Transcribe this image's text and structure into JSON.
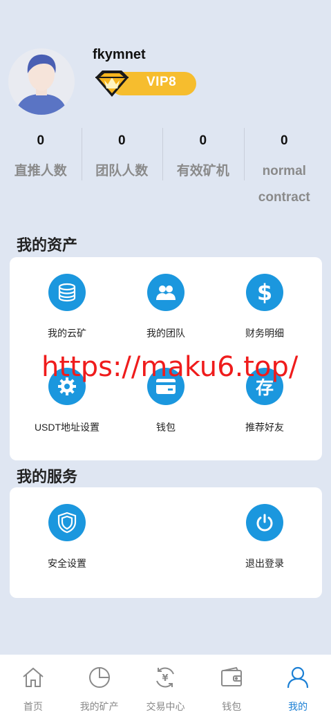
{
  "profile": {
    "username": "fkymnet",
    "vip_label": "VIP8"
  },
  "stats": [
    {
      "value": "0",
      "label": "直推人数"
    },
    {
      "value": "0",
      "label": "团队人数"
    },
    {
      "value": "0",
      "label": "有效矿机"
    },
    {
      "value": "0",
      "label": "normal contract"
    }
  ],
  "assets": {
    "title": "我的资产",
    "items": [
      {
        "label": "我的云矿",
        "icon": "database-icon"
      },
      {
        "label": "我的团队",
        "icon": "team-icon"
      },
      {
        "label": "财务明细",
        "icon": "dollar-icon"
      },
      {
        "label": "USDT地址设置",
        "icon": "gear-icon"
      },
      {
        "label": "钱包",
        "icon": "card-icon"
      },
      {
        "label": "推荐好友",
        "icon": "cun-character-icon"
      }
    ]
  },
  "services": {
    "title": "我的服务",
    "items": [
      {
        "label": "安全设置",
        "icon": "shield-icon"
      },
      {
        "label": "退出登录",
        "icon": "power-icon"
      }
    ]
  },
  "watermark": "https://maku6.top/",
  "nav": [
    {
      "label": "首页",
      "icon": "home-icon"
    },
    {
      "label": "我的矿产",
      "icon": "pie-chart-icon"
    },
    {
      "label": "交易中心",
      "icon": "exchange-icon"
    },
    {
      "label": "钱包",
      "icon": "wallet-icon"
    },
    {
      "label": "我的",
      "icon": "user-icon",
      "active": true
    }
  ],
  "colors": {
    "background": "#dfe6f2",
    "accent": "#1b97de",
    "active_nav": "#1b7fd4",
    "vip": "#f6bd2e",
    "watermark": "#ef1c1c"
  }
}
